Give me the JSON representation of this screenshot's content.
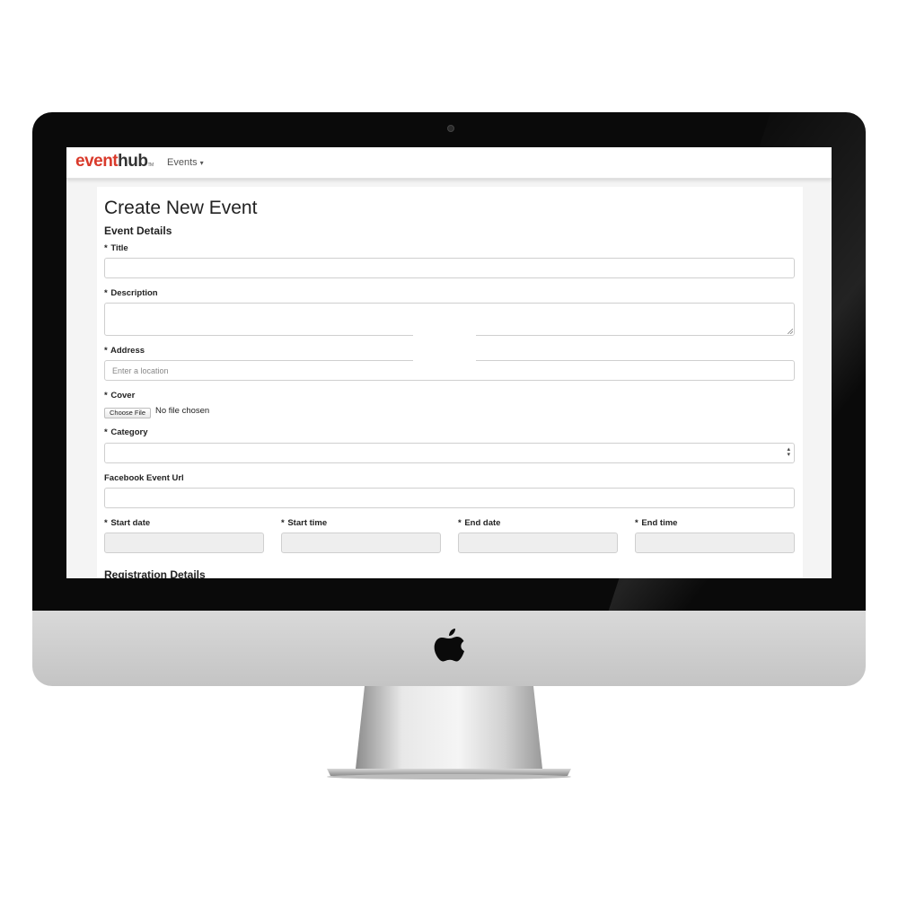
{
  "navbar": {
    "logo_part1": "event",
    "logo_part2": "hub",
    "logo_tm": "TM",
    "events_menu": "Events"
  },
  "form": {
    "page_title": "Create New Event",
    "section_event_details": "Event Details",
    "section_registration": "Registration Details",
    "title_label": "Title",
    "description_label": "Description",
    "address_label": "Address",
    "address_placeholder": "Enter a location",
    "cover_label": "Cover",
    "choose_file": "Choose File",
    "no_file": "No file chosen",
    "category_label": "Category",
    "facebook_label": "Facebook Event Url",
    "start_date_label": "Start date",
    "start_time_label": "Start time",
    "end_date_label": "End date",
    "end_time_label": "End time",
    "required_mark": "*"
  },
  "colors": {
    "brand_red": "#d93a2b",
    "bezel": "#0a0a0a",
    "chin": "#c9c9c9"
  },
  "icons": [
    "camera-icon",
    "apple-logo-icon",
    "caret-down-icon",
    "select-arrows-icon",
    "resize-handle-icon"
  ]
}
